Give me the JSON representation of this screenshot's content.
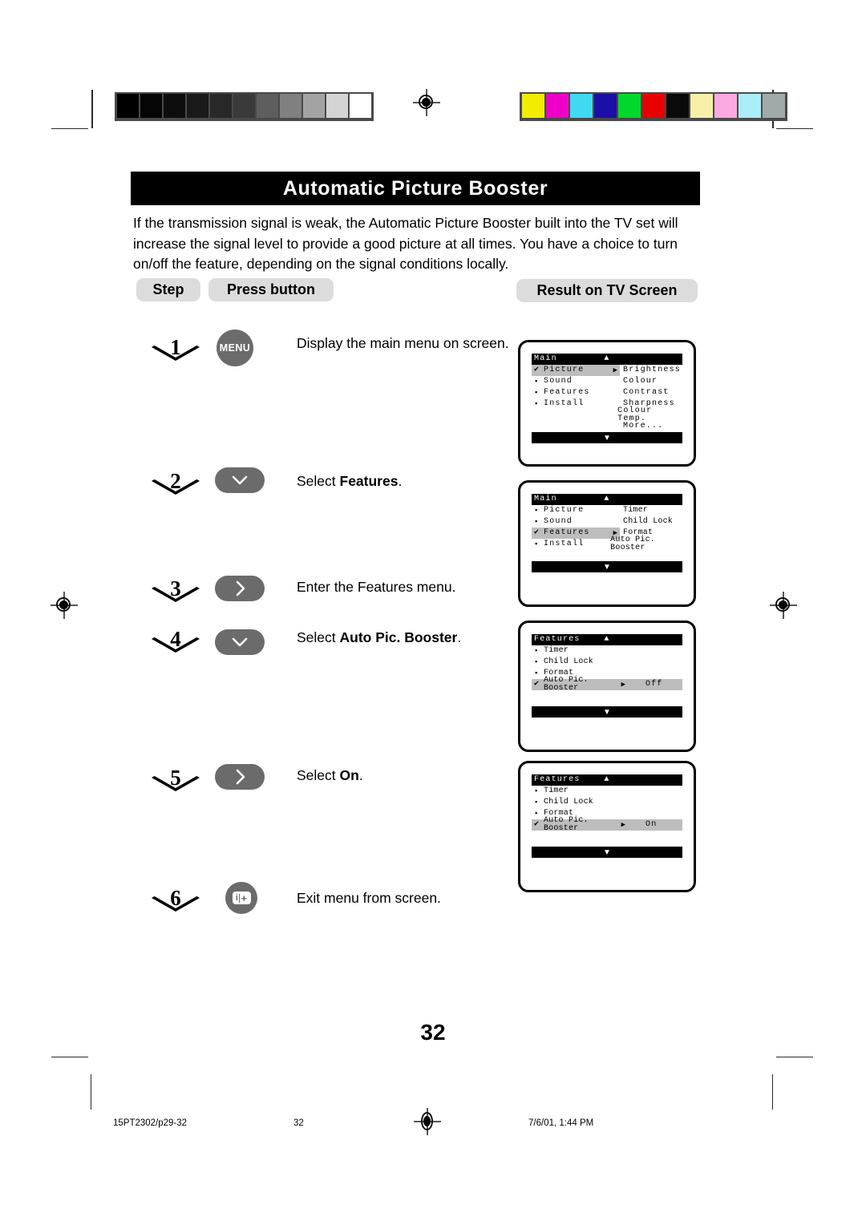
{
  "document": {
    "title": "Automatic Picture Booster",
    "intro": "If the transmission signal is weak, the Automatic Picture Booster built into the TV set will increase the signal level to provide a good picture at all times. You have a choice to turn on/off the feature, depending on the signal conditions locally.",
    "page_number": "32"
  },
  "headers": {
    "step": "Step",
    "press_button": "Press button",
    "result": "Result on TV Screen"
  },
  "steps": [
    {
      "number": "1",
      "button_label": "MENU",
      "button_icon": "menu-button",
      "description_prefix": "Display the main menu on screen.",
      "description_bold": "",
      "description_suffix": ""
    },
    {
      "number": "2",
      "button_label": "",
      "button_icon": "chevron-down-icon",
      "description_prefix": "Select ",
      "description_bold": "Features",
      "description_suffix": "."
    },
    {
      "number": "3",
      "button_label": "",
      "button_icon": "chevron-right-icon",
      "description_prefix": "Enter the Features menu.",
      "description_bold": "",
      "description_suffix": ""
    },
    {
      "number": "4",
      "button_label": "",
      "button_icon": "chevron-down-icon",
      "description_prefix": "Select ",
      "description_bold": "Auto Pic. Booster",
      "description_suffix": "."
    },
    {
      "number": "5",
      "button_label": "",
      "button_icon": "chevron-right-icon",
      "description_prefix": "Select ",
      "description_bold": "On",
      "description_suffix": "."
    },
    {
      "number": "6",
      "button_label": "",
      "button_icon": "info-plus-icon",
      "description_prefix": "Exit menu from screen.",
      "description_bold": "",
      "description_suffix": ""
    }
  ],
  "screens": [
    {
      "id": "screen-main-picture",
      "title": "Main",
      "up_arrow": "▲",
      "down_arrow": "▼",
      "rows": [
        {
          "marker": "✔",
          "label": "Picture",
          "pointer": "▶",
          "right": "Brightness",
          "highlight": true
        },
        {
          "marker": "▪",
          "label": "Sound",
          "pointer": "",
          "right": "Colour",
          "highlight": false
        },
        {
          "marker": "▪",
          "label": "Features",
          "pointer": "",
          "right": "Contrast",
          "highlight": false
        },
        {
          "marker": "▪",
          "label": "Install",
          "pointer": "",
          "right": "Sharpness",
          "highlight": false
        },
        {
          "marker": "",
          "label": "",
          "pointer": "",
          "right": "Colour Temp.",
          "highlight": false
        },
        {
          "marker": "",
          "label": "",
          "pointer": "",
          "right": "More...",
          "highlight": false
        }
      ]
    },
    {
      "id": "screen-main-features",
      "title": "Main",
      "up_arrow": "▲",
      "down_arrow": "▼",
      "rows": [
        {
          "marker": "▪",
          "label": "Picture",
          "pointer": "",
          "right": "Timer",
          "highlight": false
        },
        {
          "marker": "▪",
          "label": "Sound",
          "pointer": "",
          "right": "Child Lock",
          "highlight": false
        },
        {
          "marker": "✔",
          "label": "Features",
          "pointer": "▶",
          "right": "Format",
          "highlight": true
        },
        {
          "marker": "▪",
          "label": "Install",
          "pointer": "",
          "right": "Auto Pic. Booster",
          "highlight": false
        }
      ]
    },
    {
      "id": "screen-features-off",
      "title": "Features",
      "up_arrow": "▲",
      "down_arrow": "▼",
      "rows": [
        {
          "marker": "▪",
          "label": "Timer",
          "pointer": "",
          "right": "",
          "highlight": false
        },
        {
          "marker": "▪",
          "label": "Child Lock",
          "pointer": "",
          "right": "",
          "highlight": false
        },
        {
          "marker": "▪",
          "label": "Format",
          "pointer": "",
          "right": "",
          "highlight": false
        },
        {
          "marker": "✔",
          "label": "Auto Pic. Booster",
          "pointer": "▶",
          "right": "Off",
          "highlight": true
        }
      ]
    },
    {
      "id": "screen-features-on",
      "title": "Features",
      "up_arrow": "▲",
      "down_arrow": "▼",
      "rows": [
        {
          "marker": "▪",
          "label": "Timer",
          "pointer": "",
          "right": "",
          "highlight": false
        },
        {
          "marker": "▪",
          "label": "Child Lock",
          "pointer": "",
          "right": "",
          "highlight": false
        },
        {
          "marker": "▪",
          "label": "Format",
          "pointer": "",
          "right": "",
          "highlight": false
        },
        {
          "marker": "✔",
          "label": "Auto Pic. Booster",
          "pointer": "▶",
          "right": "On",
          "highlight": true
        }
      ]
    }
  ],
  "footer": {
    "left": "15PT2302/p29-32",
    "center": "32",
    "right": "7/6/01, 1:44 PM"
  },
  "calibration": {
    "gray_strip": [
      "#000000",
      "#050505",
      "#0d0d0d",
      "#1a1a1a",
      "#282828",
      "#3a3a3a",
      "#5e5e5e",
      "#808080",
      "#a3a3a3",
      "#d4d4d4",
      "#ffffff"
    ],
    "color_strip": [
      "#f2ed00",
      "#ee00c8",
      "#3fd9f2",
      "#1b0fa8",
      "#00d92b",
      "#e60000",
      "#0a0a0a",
      "#f7f0a8",
      "#fba9e0",
      "#aaeef7",
      "#a0aaaa"
    ]
  }
}
